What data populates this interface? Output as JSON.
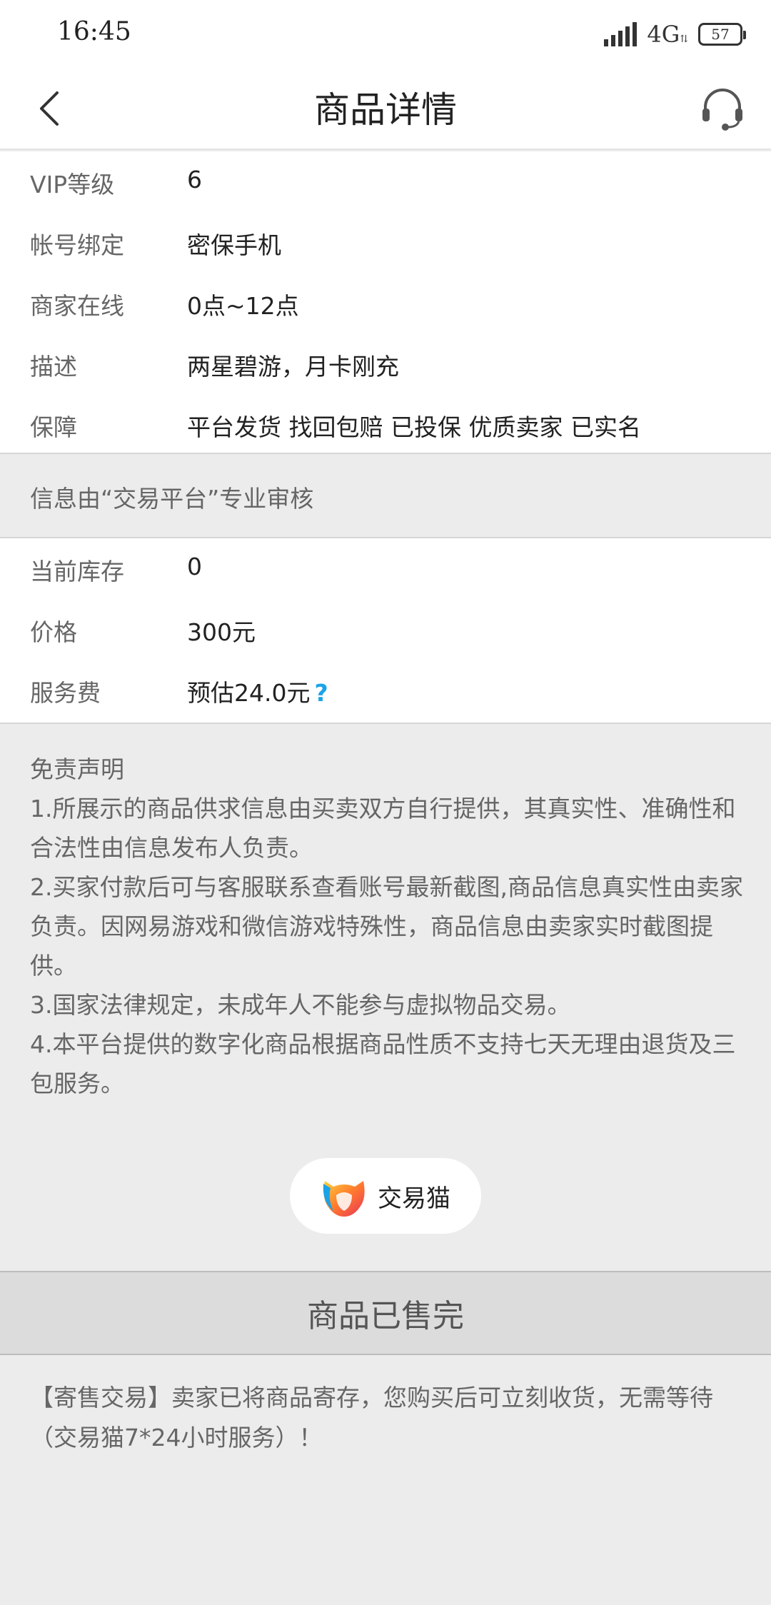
{
  "status_bar": {
    "time": "16:45",
    "network": "4G",
    "network_sub": "⇅",
    "battery": "57",
    "icons": [
      "signal-icon",
      "battery-icon"
    ]
  },
  "nav": {
    "title": "商品详情",
    "back_icon": "chevron-left-icon",
    "service_icon": "headset-icon"
  },
  "details": [
    {
      "label": "VIP等级",
      "value": "6"
    },
    {
      "label": "帐号绑定",
      "value": "密保手机"
    },
    {
      "label": "商家在线",
      "value": "0点~12点"
    },
    {
      "label": "描述",
      "value": "两星碧游，月卡刚充"
    },
    {
      "label": "保障",
      "value": "平台发货 找回包赔 已投保 优质卖家 已实名"
    }
  ],
  "audit_note": "信息由“交易平台”专业审核",
  "pricing": [
    {
      "label": "当前库存",
      "value": "0"
    },
    {
      "label": "价格",
      "value": "300元"
    },
    {
      "label": "服务费",
      "value": "预估24.0元",
      "help": "?"
    }
  ],
  "disclaimer": {
    "title": "免责声明",
    "items": [
      "1.所展示的商品供求信息由买卖双方自行提供，其真实性、准确性和合法性由信息发布人负责。",
      "2.买家付款后可与客服联系查看账号最新截图,商品信息真实性由卖家负责。因网易游戏和微信游戏特殊性，商品信息由卖家实时截图提供。",
      "3.国家法律规定，未成年人不能参与虚拟物品交易。",
      "4.本平台提供的数字化商品根据商品性质不支持七天无理由退货及三包服务。"
    ]
  },
  "brand": {
    "name": "交易猫",
    "icon": "jiaoyimao-logo-icon"
  },
  "sold_out_label": "商品已售完",
  "consign_note": "【寄售交易】卖家已将商品寄存，您购买后可立刻收货，无需等待（交易猫7*24小时服务）！",
  "colors": {
    "accent": "#1aa3e8",
    "background": "#ececec"
  }
}
